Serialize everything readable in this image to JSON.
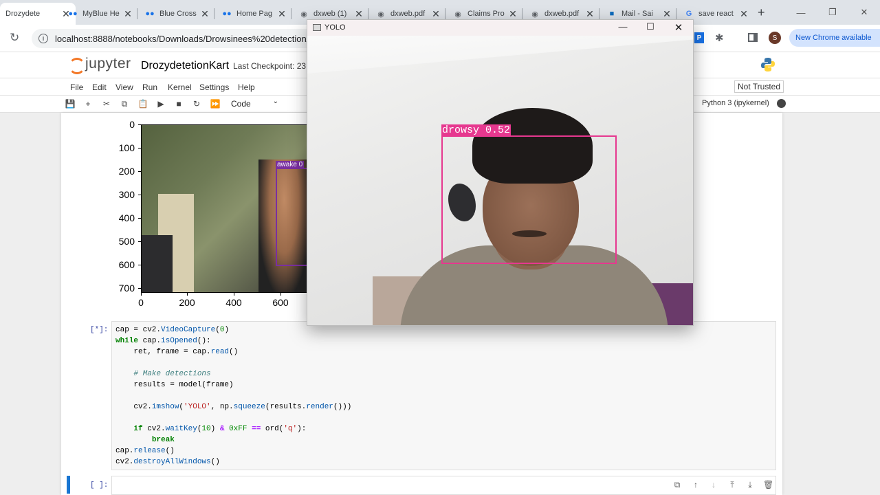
{
  "browser": {
    "tabs": [
      {
        "label": "Drozydete",
        "icon": "jupyter-icon",
        "active": true
      },
      {
        "label": "MyBlue He",
        "icon": "bluecross-icon"
      },
      {
        "label": "Blue Cross",
        "icon": "bluecross-icon"
      },
      {
        "label": "Home Pag",
        "icon": "bluecross-icon"
      },
      {
        "label": "dxweb (1)",
        "icon": "globe-icon"
      },
      {
        "label": "dxweb.pdf",
        "icon": "globe-icon"
      },
      {
        "label": "Claims Pro",
        "icon": "globe-icon"
      },
      {
        "label": "dxweb.pdf",
        "icon": "globe-icon"
      },
      {
        "label": "Mail - Sai",
        "icon": "outlook-icon"
      },
      {
        "label": "save react",
        "icon": "google-icon"
      }
    ],
    "url": "localhost:8888/notebooks/Downloads/Drowsinees%20detection/Dr",
    "profile_initial": "S",
    "update_label": "New Chrome available"
  },
  "jupyter": {
    "logo_text": "jupyter",
    "notebook_name": "DrozydetetionKart",
    "checkpoint": "Last Checkpoint: 23 h",
    "menus": [
      "File",
      "Edit",
      "View",
      "Run",
      "Kernel",
      "Settings",
      "Help"
    ],
    "trusted": "Not Trusted",
    "cell_type": "Code",
    "kernel_name": "Python 3 (ipykernel)"
  },
  "plot": {
    "yticks": [
      "0",
      "100",
      "200",
      "300",
      "400",
      "500",
      "600",
      "700"
    ],
    "xticks": [
      "0",
      "200",
      "400",
      "600"
    ],
    "detection_label": "awake 0"
  },
  "cell": {
    "prompt": "[*]:",
    "empty_prompt": "[ ]:"
  },
  "yolo_window": {
    "title": "YOLO",
    "detection_label": "drowsy 0.52"
  }
}
